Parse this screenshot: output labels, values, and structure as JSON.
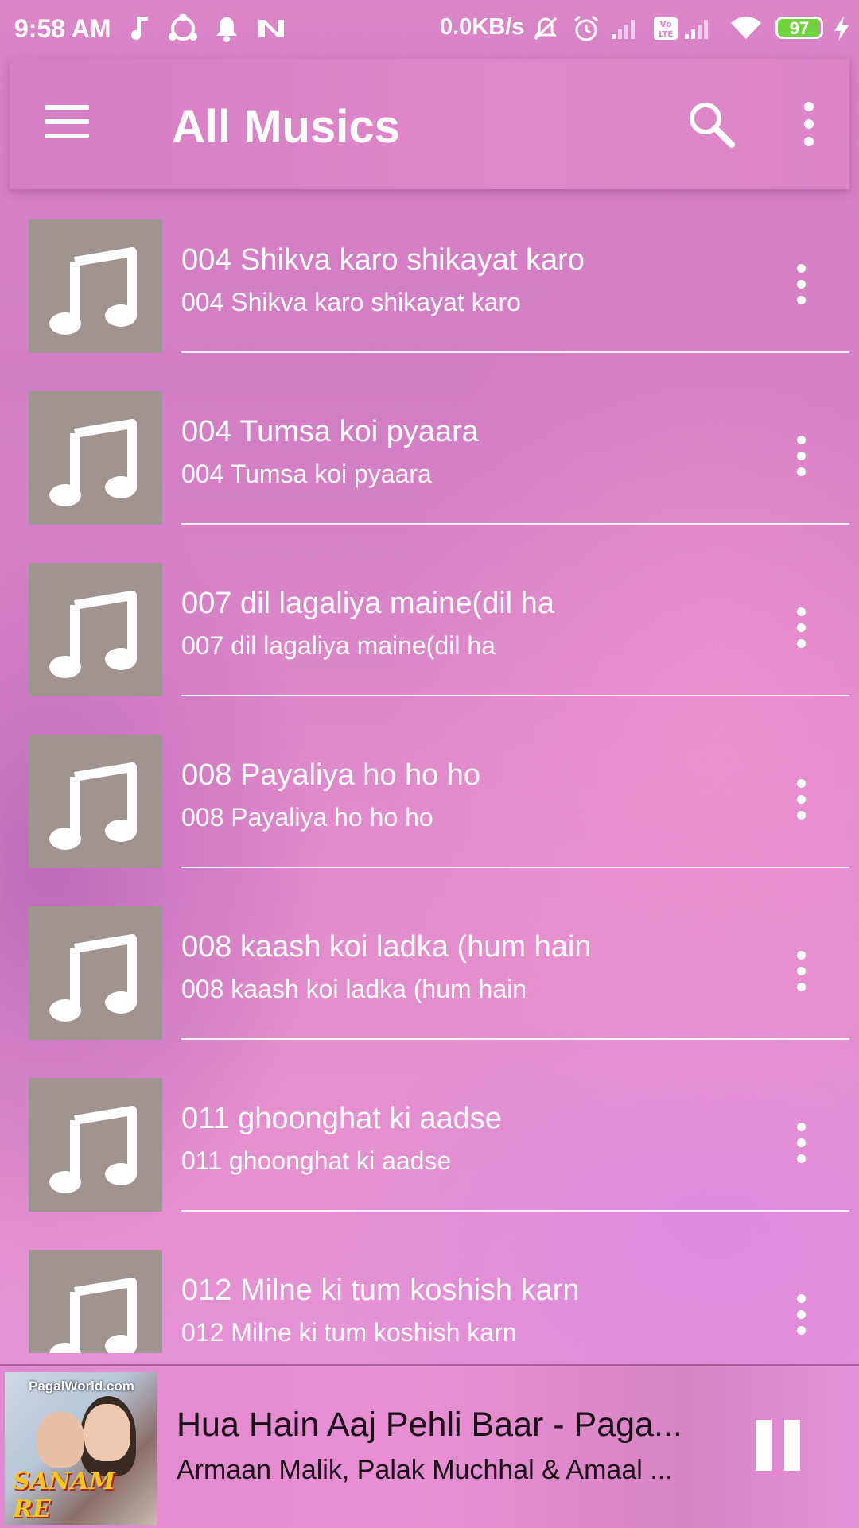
{
  "status_bar": {
    "time": "9:58 AM",
    "network_speed": "0.0KB/s",
    "battery_level": "97",
    "battery_percent": 97,
    "icons": [
      "music-note-icon",
      "share-hub-icon",
      "bell-icon",
      "n-app-icon",
      "mute-icon",
      "alarm-icon",
      "signal-icon",
      "volte-icon",
      "signal-icon",
      "wifi-icon",
      "battery-icon",
      "charging-icon"
    ]
  },
  "app_bar": {
    "title": "All Musics",
    "icons": [
      "hamburger-menu-icon",
      "search-icon",
      "more-vert-icon"
    ]
  },
  "songs": [
    {
      "title": "004 Shikva karo shikayat karo",
      "subtitle": "004 Shikva karo shikayat karo"
    },
    {
      "title": "004 Tumsa koi pyaara",
      "subtitle": "004 Tumsa koi pyaara"
    },
    {
      "title": "007 dil lagaliya maine(dil ha",
      "subtitle": "007 dil lagaliya maine(dil ha"
    },
    {
      "title": "008 Payaliya ho ho ho",
      "subtitle": "008 Payaliya ho ho ho"
    },
    {
      "title": "008 kaash koi ladka (hum hain",
      "subtitle": "008 kaash koi ladka (hum hain"
    },
    {
      "title": "011 ghoonghat ki aadse",
      "subtitle": "011 ghoonghat ki aadse"
    },
    {
      "title": "012 Milne ki tum koshish karn",
      "subtitle": "012 Milne ki tum koshish karn"
    }
  ],
  "now_playing": {
    "title": "Hua Hain Aaj Pehli Baar - Paga...",
    "artist": "Armaan Malik, Palak Muchhal & Amaal ...",
    "cover_text": "PagalWorld.com",
    "cover_logo": "SANAM RE"
  },
  "colors": {
    "artwork_placeholder": "#a09490",
    "battery_fill": "#6fd33c",
    "now_playing_text": "#1a0f18"
  }
}
